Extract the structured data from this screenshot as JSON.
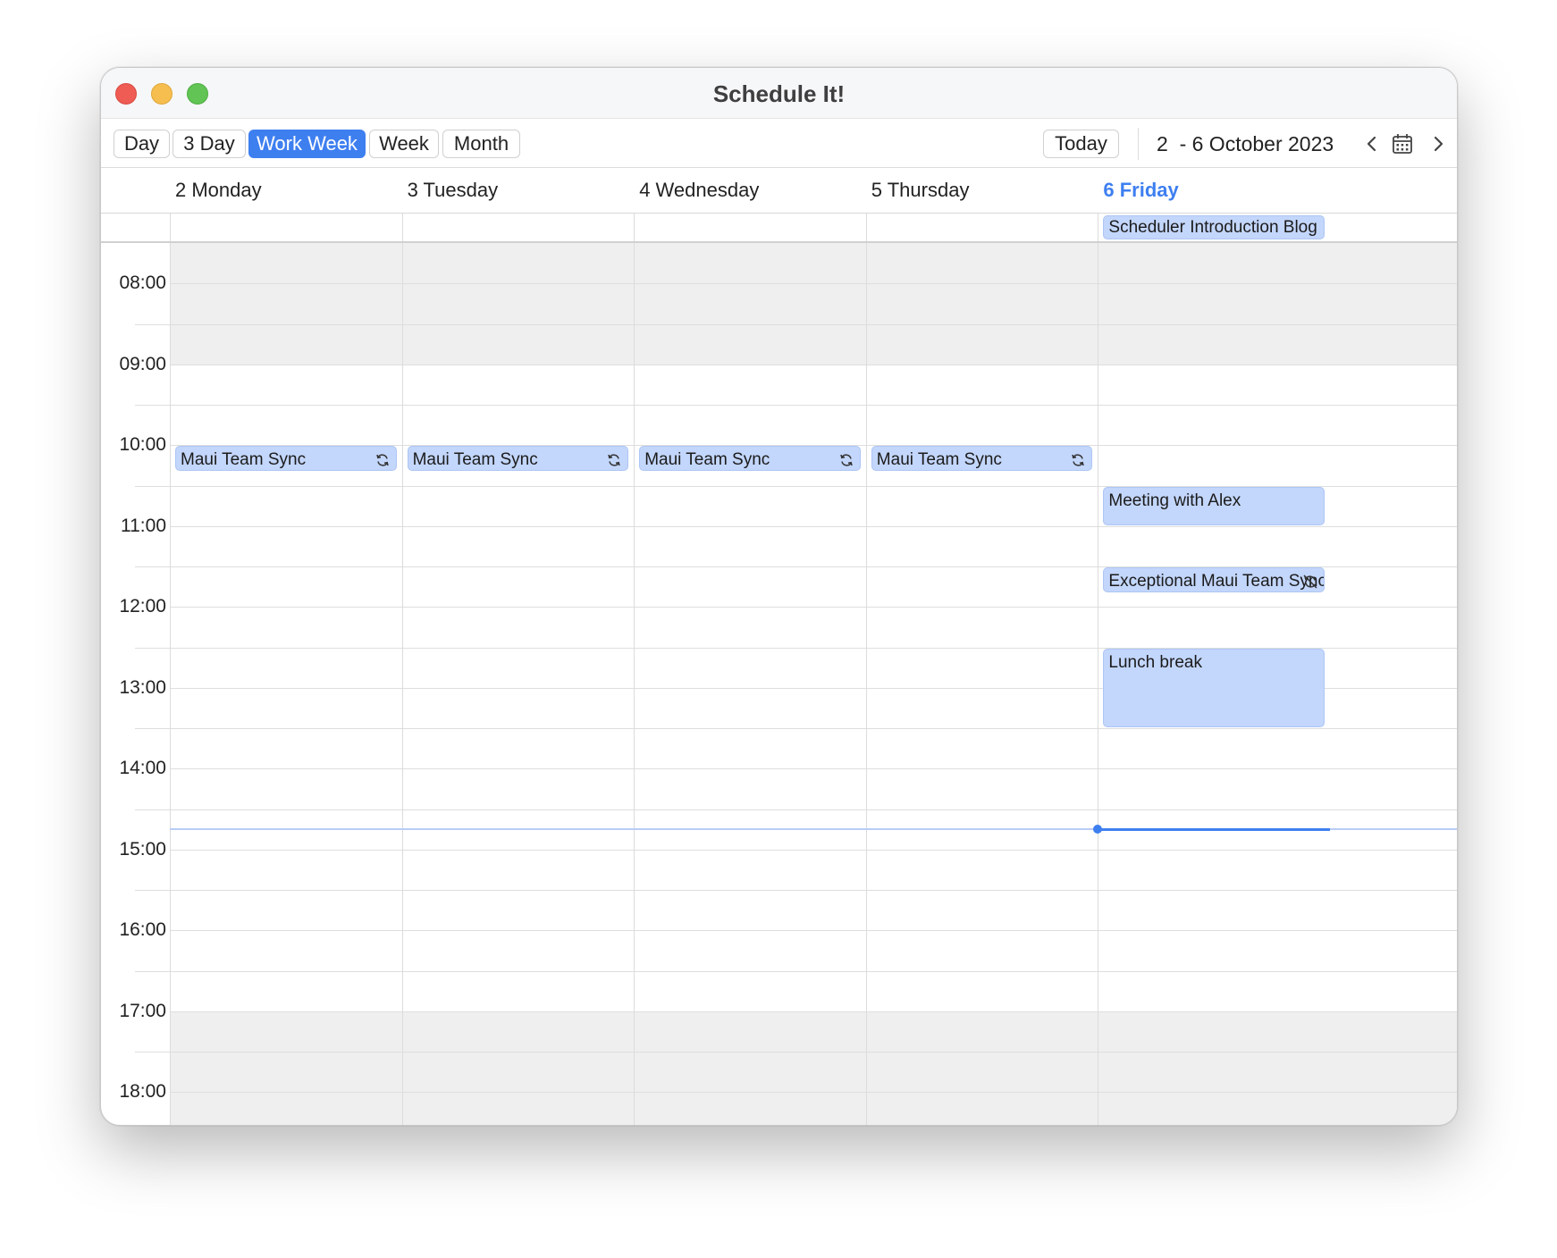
{
  "window": {
    "title": "Schedule It!"
  },
  "toolbar": {
    "views": [
      {
        "label": "Day",
        "active": false
      },
      {
        "label": "3 Day",
        "active": false
      },
      {
        "label": "Work Week",
        "active": true
      },
      {
        "label": "Week",
        "active": false
      },
      {
        "label": "Month",
        "active": false
      }
    ],
    "today_label": "Today",
    "date_range": "2  - 6 October 2023",
    "icons": {
      "prev": "chevron-left-icon",
      "calendar": "calendar-icon",
      "next": "chevron-right-icon"
    }
  },
  "days": [
    {
      "label": "2 Monday",
      "today": false
    },
    {
      "label": "3 Tuesday",
      "today": false
    },
    {
      "label": "4 Wednesday",
      "today": false
    },
    {
      "label": "5 Thursday",
      "today": false
    },
    {
      "label": "6 Friday",
      "today": true
    }
  ],
  "all_day_events": [
    {
      "title": "Scheduler Introduction Blog",
      "day": 4
    }
  ],
  "time_labels": [
    "08:00",
    "09:00",
    "10:00",
    "11:00",
    "12:00",
    "13:00",
    "14:00",
    "15:00",
    "16:00",
    "17:00",
    "18:00"
  ],
  "grid": {
    "start_hour": 7.5,
    "end_hour": 18.5,
    "work_start": 9,
    "work_end": 17,
    "now_hour": 14.75
  },
  "events": [
    {
      "title": "Maui Team Sync",
      "day": 0,
      "start": 10,
      "end": 10.33,
      "icon": "recurring-icon"
    },
    {
      "title": "Maui Team Sync",
      "day": 1,
      "start": 10,
      "end": 10.33,
      "icon": "recurring-icon"
    },
    {
      "title": "Maui Team Sync",
      "day": 2,
      "start": 10,
      "end": 10.33,
      "icon": "recurring-icon"
    },
    {
      "title": "Maui Team Sync",
      "day": 3,
      "start": 10,
      "end": 10.33,
      "icon": "recurring-icon"
    },
    {
      "title": "Meeting with Alex",
      "day": 4,
      "start": 10.5,
      "end": 11,
      "icon": ""
    },
    {
      "title": "Exceptional Maui Team Sync",
      "day": 4,
      "start": 11.5,
      "end": 11.83,
      "icon": "recurring-exception-icon"
    },
    {
      "title": "Lunch break",
      "day": 4,
      "start": 12.5,
      "end": 13.5,
      "icon": ""
    }
  ],
  "colors": {
    "accent": "#3e7ff0",
    "event_bg": "#c3d6fb",
    "offhours_bg": "#efefef"
  }
}
